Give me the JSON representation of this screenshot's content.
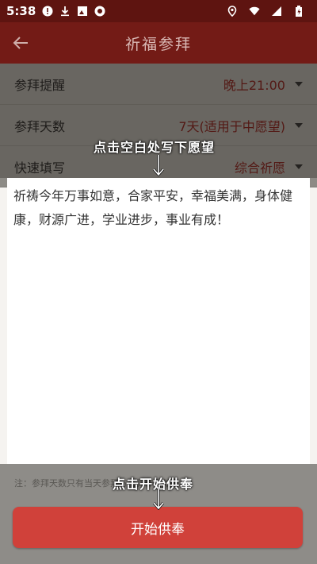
{
  "status": {
    "time": "5:38"
  },
  "appbar": {
    "title": "祈福参拜"
  },
  "rows": [
    {
      "label": "参拜提醒",
      "value": "晚上21:00"
    },
    {
      "label": "参拜天数",
      "value": "7天(适用于中愿望)"
    },
    {
      "label": "快速填写",
      "value": "综合祈愿"
    }
  ],
  "wish_text": "祈祷今年万事如意，合家平安，幸福美满，身体健康，财源广进，学业进步，事业有成！",
  "note": "注：参拜天数只有当天参拜方可算作有效参拜。",
  "cta_label": "开始供奉",
  "hints": {
    "wish": "点击空白处写下愿望",
    "start": "点击开始供奉"
  },
  "colors": {
    "appbar": "#731b16",
    "statusbar": "#5e1410",
    "cta": "#d0413a",
    "value_text": "#6a1512"
  }
}
